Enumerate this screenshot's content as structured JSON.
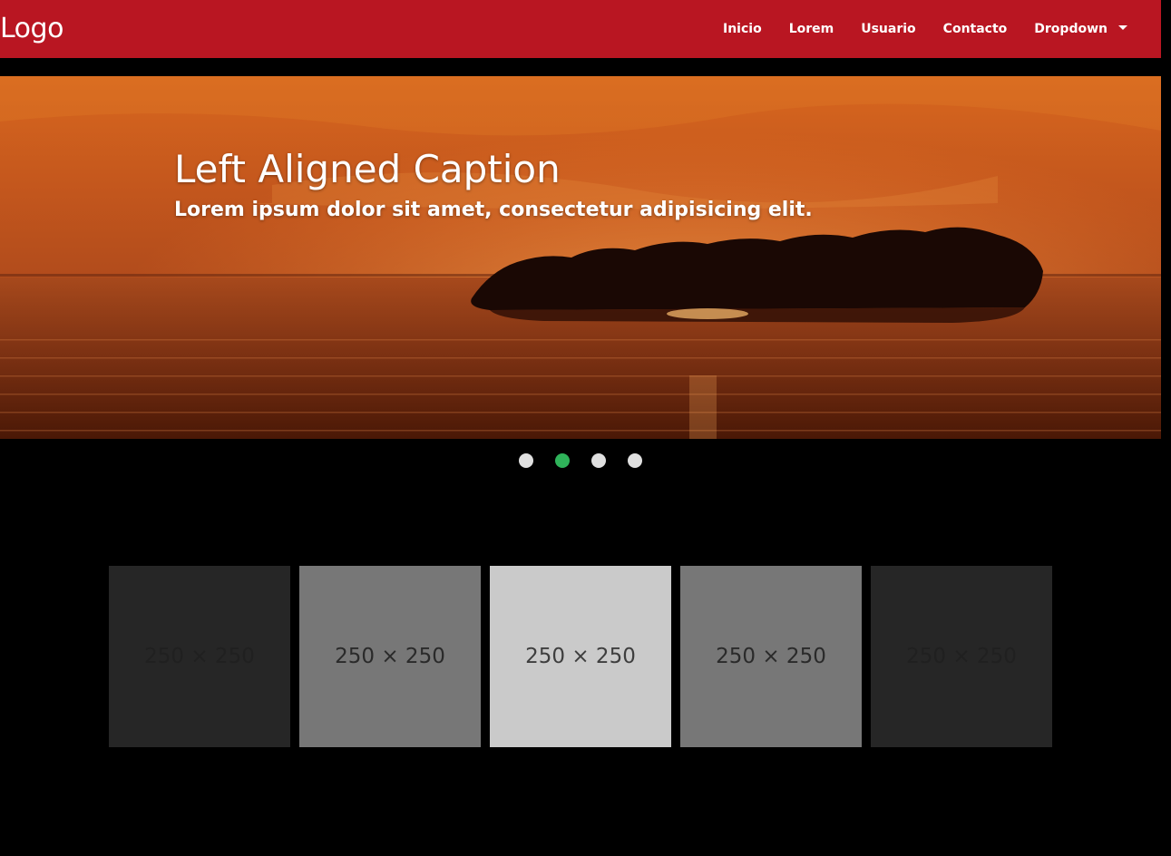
{
  "navbar": {
    "logo": "Logo",
    "items": [
      {
        "label": "Inicio"
      },
      {
        "label": "Lorem"
      },
      {
        "label": "Usuario"
      },
      {
        "label": "Contacto"
      },
      {
        "label": "Dropdown"
      }
    ],
    "background": "#b91622"
  },
  "carousel": {
    "caption_title": "Left Aligned Caption",
    "caption_text": "Lorem ipsum dolor sit amet, consectetur adipisicing elit.",
    "indicator_count": 4,
    "active_index": 1,
    "active_color": "#2fb35a"
  },
  "thumbnails": [
    {
      "label": "250 × 250"
    },
    {
      "label": "250 × 250"
    },
    {
      "label": "250 × 250"
    },
    {
      "label": "250 × 250"
    },
    {
      "label": "250 × 250"
    }
  ]
}
